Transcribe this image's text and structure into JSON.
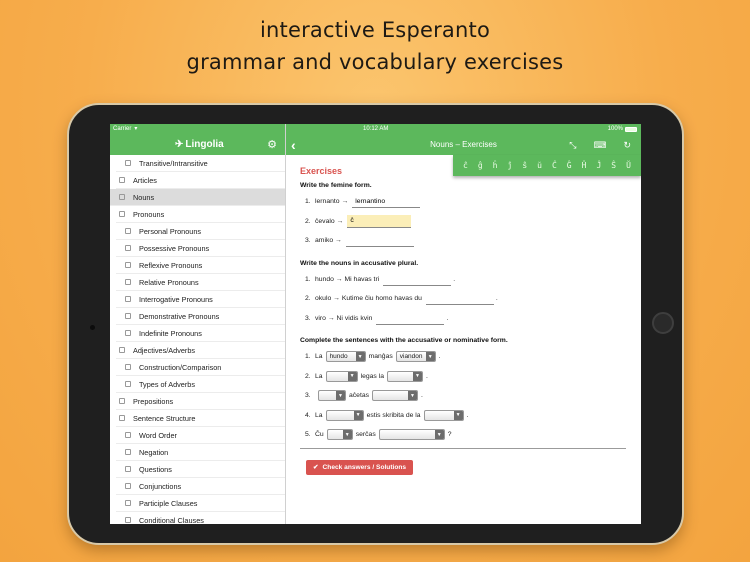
{
  "headline": {
    "line1": "interactive Esperanto",
    "line2": "grammar and vocabulary exercises"
  },
  "status_bar": {
    "carrier": "Carrier",
    "time": "10:12 AM",
    "battery": "100%"
  },
  "sidebar": {
    "brand": "Lingolia",
    "settings_icon": "gear-icon",
    "items": [
      {
        "label": "Transitive/Intransitive",
        "level": 2,
        "active": false
      },
      {
        "label": "Articles",
        "level": 1,
        "active": false
      },
      {
        "label": "Nouns",
        "level": 1,
        "active": true
      },
      {
        "label": "Pronouns",
        "level": 1,
        "active": false
      },
      {
        "label": "Personal Pronouns",
        "level": 2,
        "active": false
      },
      {
        "label": "Possessive Pronouns",
        "level": 2,
        "active": false
      },
      {
        "label": "Reflexive Pronouns",
        "level": 2,
        "active": false
      },
      {
        "label": "Relative Pronouns",
        "level": 2,
        "active": false
      },
      {
        "label": "Interrogative Pronouns",
        "level": 2,
        "active": false
      },
      {
        "label": "Demonstrative Pronouns",
        "level": 2,
        "active": false
      },
      {
        "label": "Indefinite Pronouns",
        "level": 2,
        "active": false
      },
      {
        "label": "Adjectives/Adverbs",
        "level": 1,
        "active": false
      },
      {
        "label": "Construction/Comparison",
        "level": 2,
        "active": false
      },
      {
        "label": "Types of Adverbs",
        "level": 2,
        "active": false
      },
      {
        "label": "Prepositions",
        "level": 1,
        "active": false
      },
      {
        "label": "Sentence Structure",
        "level": 1,
        "active": false
      },
      {
        "label": "Word Order",
        "level": 2,
        "active": false
      },
      {
        "label": "Negation",
        "level": 2,
        "active": false
      },
      {
        "label": "Questions",
        "level": 2,
        "active": false
      },
      {
        "label": "Conjunctions",
        "level": 2,
        "active": false
      },
      {
        "label": "Participle Clauses",
        "level": 2,
        "active": false
      },
      {
        "label": "Conditional Clauses",
        "level": 2,
        "active": false
      }
    ]
  },
  "main": {
    "back_icon": "chevron-left-icon",
    "title": "Nouns – Exercises",
    "icons": [
      "expand-icon",
      "keyboard-icon",
      "refresh-icon"
    ],
    "special_chars": [
      "ĉ",
      "ĝ",
      "ĥ",
      "ĵ",
      "ŝ",
      "ŭ",
      "Ĉ",
      "Ĝ",
      "Ĥ",
      "Ĵ",
      "Ŝ",
      "Ŭ"
    ],
    "heading": "Exercises",
    "section1": {
      "instruction": "Write the femine form.",
      "rows": [
        {
          "num": "1.",
          "prompt": "lernanto →",
          "value": "lernantino",
          "active": false
        },
        {
          "num": "2.",
          "prompt": "ĉevalo →",
          "value": "ĉ",
          "active": true
        },
        {
          "num": "3.",
          "prompt": "amiko →",
          "value": "",
          "active": false
        }
      ]
    },
    "section2": {
      "instruction": "Write the nouns in accusative plural.",
      "rows": [
        {
          "num": "1.",
          "prompt": "hundo → Mi havas tri",
          "value": "",
          "suffix": "."
        },
        {
          "num": "2.",
          "prompt": "okulo → Kutime ĉiu homo havas du",
          "value": "",
          "suffix": "."
        },
        {
          "num": "3.",
          "prompt": "viro → Ni vidis kvin",
          "value": "",
          "suffix": "."
        }
      ]
    },
    "section3": {
      "instruction": "Complete the sentences with the accusative or nominative form.",
      "rows": [
        {
          "num": "1.",
          "a": "La",
          "sel1": "hundo",
          "b": "manĝas",
          "sel2": "viandon",
          "end": "."
        },
        {
          "num": "2.",
          "a": "La",
          "sel1": "",
          "b": "legas la",
          "sel2": "",
          "end": "."
        },
        {
          "num": "3.",
          "a": "",
          "sel1": "",
          "b": "aĉetas",
          "sel2": "",
          "end": "."
        },
        {
          "num": "4.",
          "a": "La",
          "sel1": "",
          "b": "estis skribita de la",
          "sel2": "",
          "end": "."
        },
        {
          "num": "5.",
          "a": "Ĉu",
          "sel1": "",
          "b": "serĉas",
          "sel2": "",
          "end": "?"
        }
      ]
    },
    "check_button": "Check answers / Solutions"
  }
}
